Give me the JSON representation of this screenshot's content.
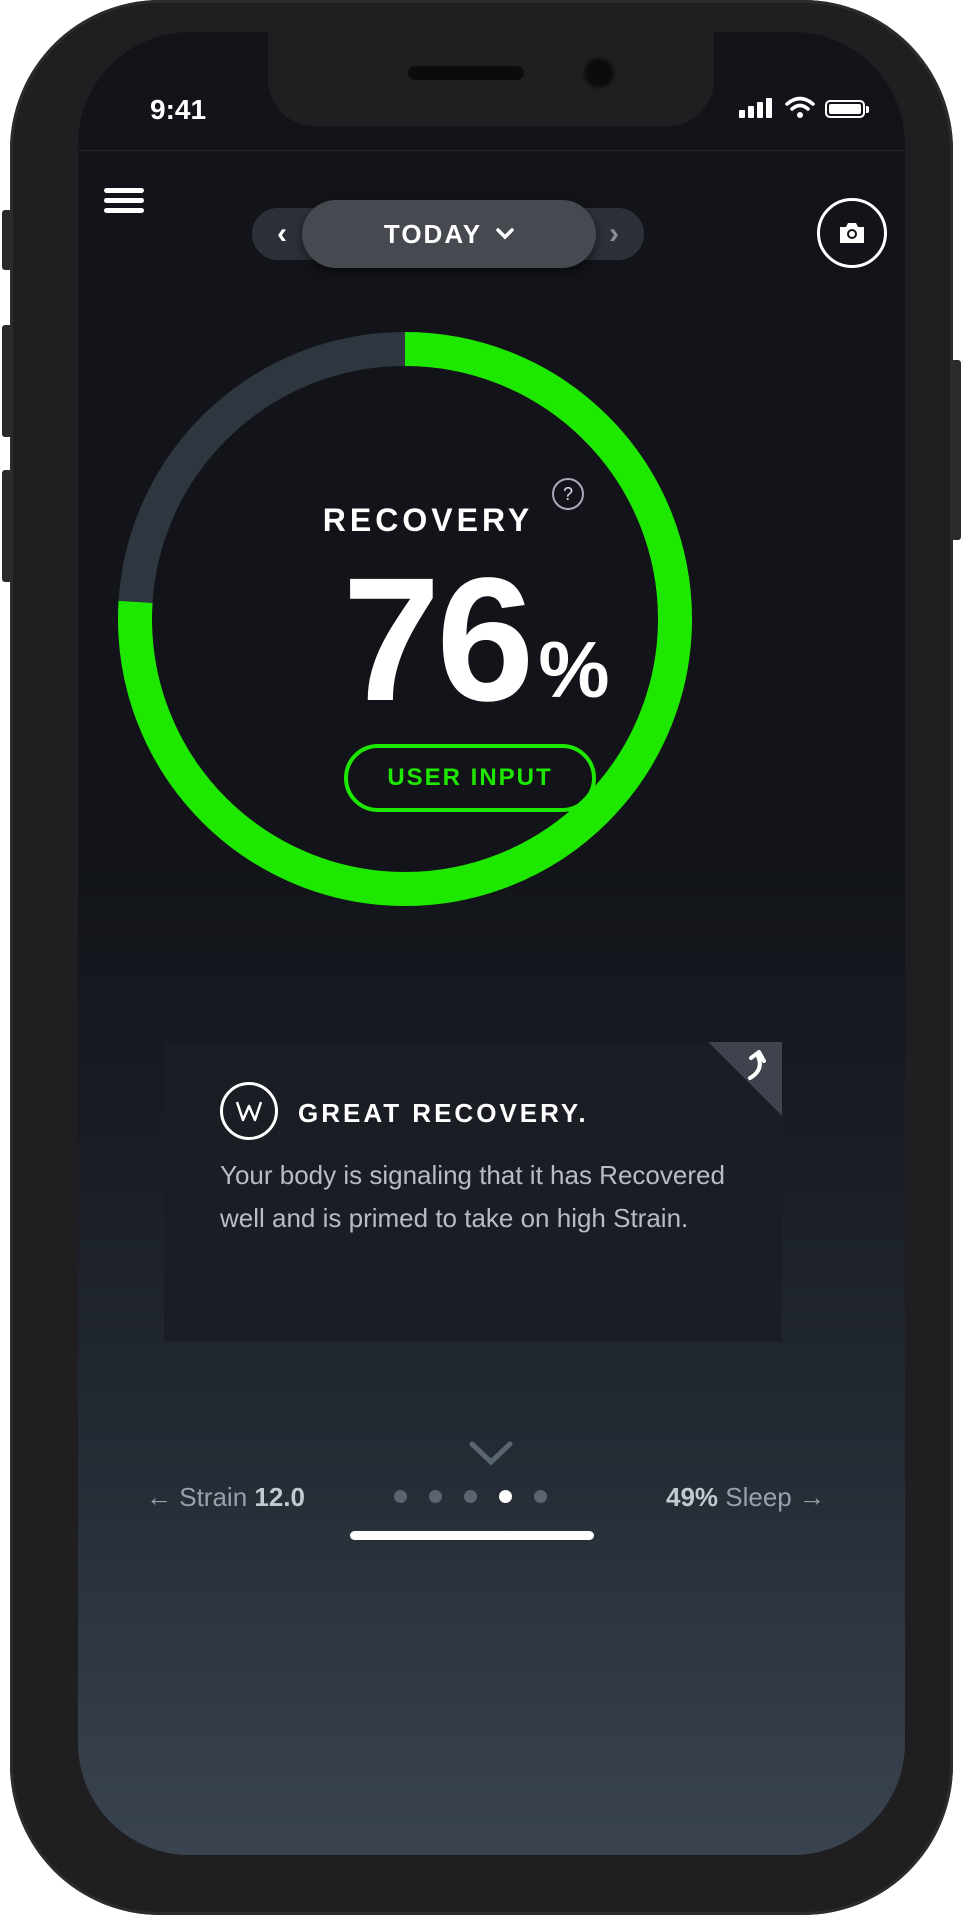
{
  "status_bar": {
    "time": "9:41"
  },
  "header": {
    "date_label": "TODAY",
    "prev_arrow": "‹",
    "next_arrow": "›"
  },
  "recovery": {
    "label": "RECOVERY",
    "value": "76",
    "unit": "%",
    "percent": 76,
    "help": "?",
    "user_input_label": "USER INPUT",
    "ring_color": "#1ee800",
    "track_color": "#2e3640"
  },
  "card": {
    "title": "GREAT RECOVERY.",
    "body": "Your body is signaling that it has Recovered well and is primed to take on high Strain."
  },
  "footer": {
    "left_label": "Strain",
    "left_value": "12.0",
    "right_value": "49%",
    "right_label": "Sleep",
    "pages": 5,
    "active_page": 3
  },
  "icons": [
    "menu-icon",
    "chevron-left-icon",
    "chevron-down-icon",
    "chevron-right-icon",
    "camera-icon",
    "help-icon",
    "whoop-logo-icon",
    "share-arrow-icon"
  ]
}
